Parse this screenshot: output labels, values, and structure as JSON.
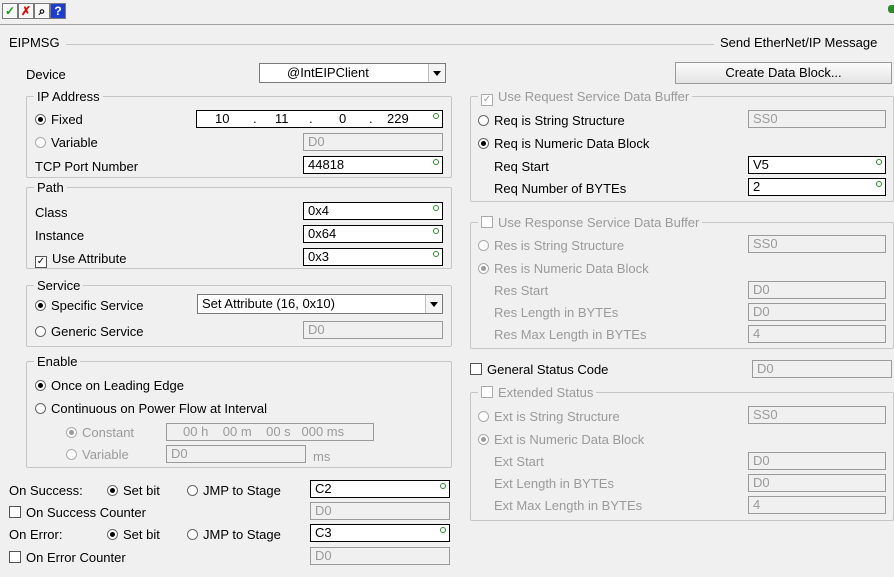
{
  "toolbar": {
    "accept_icon": "✓",
    "cancel_icon": "✗",
    "find_icon": "⌕",
    "help_icon": "?"
  },
  "header": {
    "title": "EIPMSG",
    "description": "Send EtherNet/IP Message"
  },
  "device": {
    "label": "Device",
    "value": "@IntEIPClient"
  },
  "create_button": "Create Data Block...",
  "ip": {
    "group": "IP Address",
    "fixed_label": "Fixed",
    "octets": [
      "10",
      "11",
      "0",
      "229"
    ],
    "variable_label": "Variable",
    "variable_value": "D0",
    "port_label": "TCP Port Number",
    "port_value": "44818"
  },
  "path": {
    "group": "Path",
    "class_label": "Class",
    "class_value": "0x4",
    "instance_label": "Instance",
    "instance_value": "0x64",
    "attribute_label": "Use Attribute",
    "attribute_value": "0x3"
  },
  "service": {
    "group": "Service",
    "specific_label": "Specific Service",
    "specific_value": "Set Attribute (16, 0x10)",
    "generic_label": "Generic Service",
    "generic_value": "D0"
  },
  "enable": {
    "group": "Enable",
    "once_label": "Once on Leading Edge",
    "continuous_label": "Continuous on Power Flow at Interval",
    "constant_label": "Constant",
    "constant_value": "00 h    00 m    00 s   000 ms",
    "variable_label": "Variable",
    "variable_value": "D0",
    "ms_label": "ms"
  },
  "success": {
    "label": "On Success:",
    "set_bit": "Set bit",
    "jmp": "JMP to Stage",
    "value": "C2",
    "counter_label": "On Success Counter",
    "counter_value": "D0"
  },
  "error": {
    "label": "On Error:",
    "set_bit": "Set bit",
    "jmp": "JMP to Stage",
    "value": "C3",
    "counter_label": "On Error Counter",
    "counter_value": "D0"
  },
  "request": {
    "group": "Use Request Service Data Buffer",
    "string_label": "Req is String Structure",
    "string_value": "SS0",
    "numeric_label": "Req is Numeric Data Block",
    "start_label": "Req Start",
    "start_value": "V5",
    "bytes_label": "Req Number of BYTEs",
    "bytes_value": "2"
  },
  "response": {
    "group": "Use Response Service Data Buffer",
    "string_label": "Res is String Structure",
    "string_value": "SS0",
    "numeric_label": "Res is Numeric Data Block",
    "start_label": "Res Start",
    "start_value": "D0",
    "length_label": "Res Length in BYTEs",
    "length_value": "D0",
    "max_label": "Res Max Length in BYTEs",
    "max_value": "4"
  },
  "general_status": {
    "label": "General Status Code",
    "value": "D0"
  },
  "extended": {
    "group": "Extended Status",
    "string_label": "Ext is String Structure",
    "string_value": "SS0",
    "numeric_label": "Ext is Numeric Data Block",
    "start_label": "Ext Start",
    "start_value": "D0",
    "length_label": "Ext Length in BYTEs",
    "length_value": "D0",
    "max_label": "Ext Max Length in BYTEs",
    "max_value": "4"
  },
  "colors": {
    "ok": "#1a9a1a",
    "cancel": "#d01010",
    "help": "#1a3fd0",
    "status_dot": "#2e8b2e"
  }
}
